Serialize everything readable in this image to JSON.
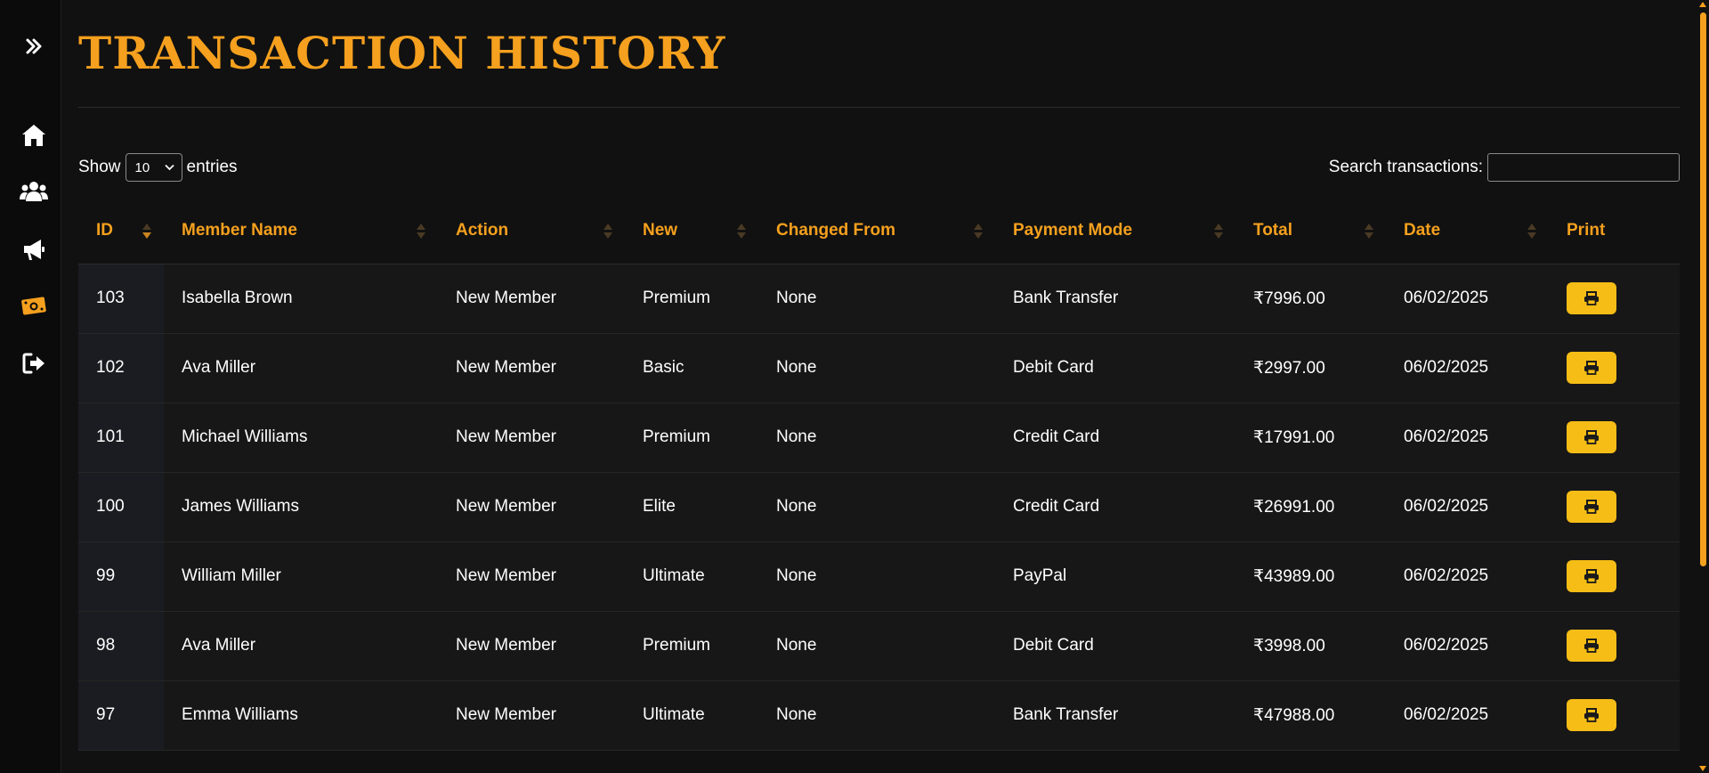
{
  "page_title": "TRANSACTION HISTORY",
  "length_control": {
    "prefix": "Show",
    "selected": "10",
    "suffix": "entries"
  },
  "search": {
    "label": "Search transactions:",
    "value": "",
    "placeholder": ""
  },
  "sidebar": {
    "items": [
      {
        "icon": "expand-icon"
      },
      {
        "icon": "home-icon"
      },
      {
        "icon": "members-icon"
      },
      {
        "icon": "announcements-icon"
      },
      {
        "icon": "transactions-icon",
        "active": true
      },
      {
        "icon": "logout-icon"
      }
    ]
  },
  "table": {
    "headers": [
      "ID",
      "Member Name",
      "Action",
      "New",
      "Changed From",
      "Payment Mode",
      "Total",
      "Date",
      "Print"
    ],
    "rows": [
      {
        "id": "103",
        "name": "Isabella Brown",
        "action": "New Member",
        "new": "Premium",
        "changed_from": "None",
        "payment": "Bank Transfer",
        "total": "₹7996.00",
        "date": "06/02/2025"
      },
      {
        "id": "102",
        "name": "Ava Miller",
        "action": "New Member",
        "new": "Basic",
        "changed_from": "None",
        "payment": "Debit Card",
        "total": "₹2997.00",
        "date": "06/02/2025"
      },
      {
        "id": "101",
        "name": "Michael Williams",
        "action": "New Member",
        "new": "Premium",
        "changed_from": "None",
        "payment": "Credit Card",
        "total": "₹17991.00",
        "date": "06/02/2025"
      },
      {
        "id": "100",
        "name": "James Williams",
        "action": "New Member",
        "new": "Elite",
        "changed_from": "None",
        "payment": "Credit Card",
        "total": "₹26991.00",
        "date": "06/02/2025"
      },
      {
        "id": "99",
        "name": "William Miller",
        "action": "New Member",
        "new": "Ultimate",
        "changed_from": "None",
        "payment": "PayPal",
        "total": "₹43989.00",
        "date": "06/02/2025"
      },
      {
        "id": "98",
        "name": "Ava Miller",
        "action": "New Member",
        "new": "Premium",
        "changed_from": "None",
        "payment": "Debit Card",
        "total": "₹3998.00",
        "date": "06/02/2025"
      },
      {
        "id": "97",
        "name": "Emma Williams",
        "action": "New Member",
        "new": "Ultimate",
        "changed_from": "None",
        "payment": "Bank Transfer",
        "total": "₹47988.00",
        "date": "06/02/2025"
      }
    ]
  },
  "colors": {
    "accent": "#f5a01e",
    "print_button": "#f6bd16",
    "background": "#111111"
  }
}
